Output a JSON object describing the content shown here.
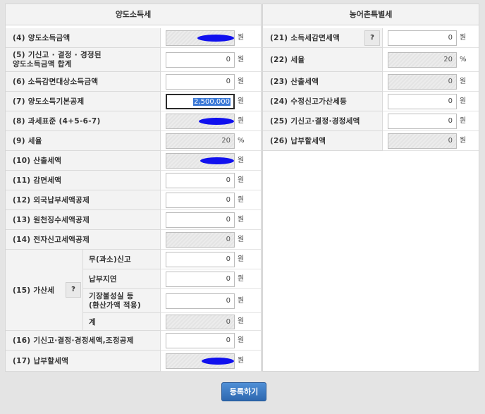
{
  "left": {
    "header": "양도소득세",
    "rows": {
      "r4": {
        "label": "(4) 양도소득금액",
        "unit": "원"
      },
      "r5": {
        "label_line1": "(5) 기신고 · 결정 · 경정된",
        "label_line2": "양도소득금액 합계",
        "value": "0",
        "unit": "원"
      },
      "r6": {
        "label": "(6) 소득감면대상소득금액",
        "value": "0",
        "unit": "원"
      },
      "r7": {
        "label": "(7) 양도소득기본공제",
        "value": "2,500,000",
        "unit": "원"
      },
      "r8": {
        "label": "(8) 과세표준 (4+5-6-7)",
        "unit": "원"
      },
      "r9": {
        "label": "(9) 세율",
        "value": "20",
        "unit": "%"
      },
      "r10": {
        "label": "(10) 산출세액",
        "unit": "원"
      },
      "r11": {
        "label": "(11) 감면세액",
        "value": "0",
        "unit": "원"
      },
      "r12": {
        "label": "(12) 외국납부세액공제",
        "value": "0",
        "unit": "원"
      },
      "r13": {
        "label": "(13) 원천징수세액공제",
        "value": "0",
        "unit": "원"
      },
      "r14": {
        "label": "(14) 전자신고세액공제",
        "value": "0",
        "unit": "원"
      },
      "r15": {
        "label": "(15) 가산세",
        "help": "?",
        "sub": [
          {
            "label": "무(과소)신고",
            "value": "0",
            "unit": "원"
          },
          {
            "label": "납부지연",
            "value": "0",
            "unit": "원"
          },
          {
            "label_line1": "기장불성실 등",
            "label_line2": "(환산가액 적용)",
            "value": "0",
            "unit": "원"
          },
          {
            "label": "계",
            "value": "0",
            "unit": "원"
          }
        ]
      },
      "r16": {
        "label": "(16) 기신고·결정·경정세액,조정공제",
        "value": "0",
        "unit": "원"
      },
      "r17": {
        "label": "(17) 납부할세액",
        "unit": "원"
      }
    }
  },
  "right": {
    "header": "농어촌특별세",
    "rows": {
      "r21": {
        "label": "(21) 소득세감면세액",
        "help": "?",
        "value": "0",
        "unit": "원"
      },
      "r22": {
        "label": "(22) 세율",
        "value": "20",
        "unit": "%"
      },
      "r23": {
        "label": "(23) 산출세액",
        "value": "0",
        "unit": "원"
      },
      "r24": {
        "label": "(24) 수정신고가산세등",
        "value": "0",
        "unit": "원"
      },
      "r25": {
        "label": "(25) 기신고·결정·경정세액",
        "value": "0",
        "unit": "원"
      },
      "r26": {
        "label": "(26) 납부할세액",
        "value": "0",
        "unit": "원"
      }
    }
  },
  "submit_label": "등록하기",
  "colors": {
    "redaction": "#1010ee",
    "button": "#3a78c8",
    "label_bg": "#f3f3f3",
    "readonly_bg": "#ececec"
  }
}
